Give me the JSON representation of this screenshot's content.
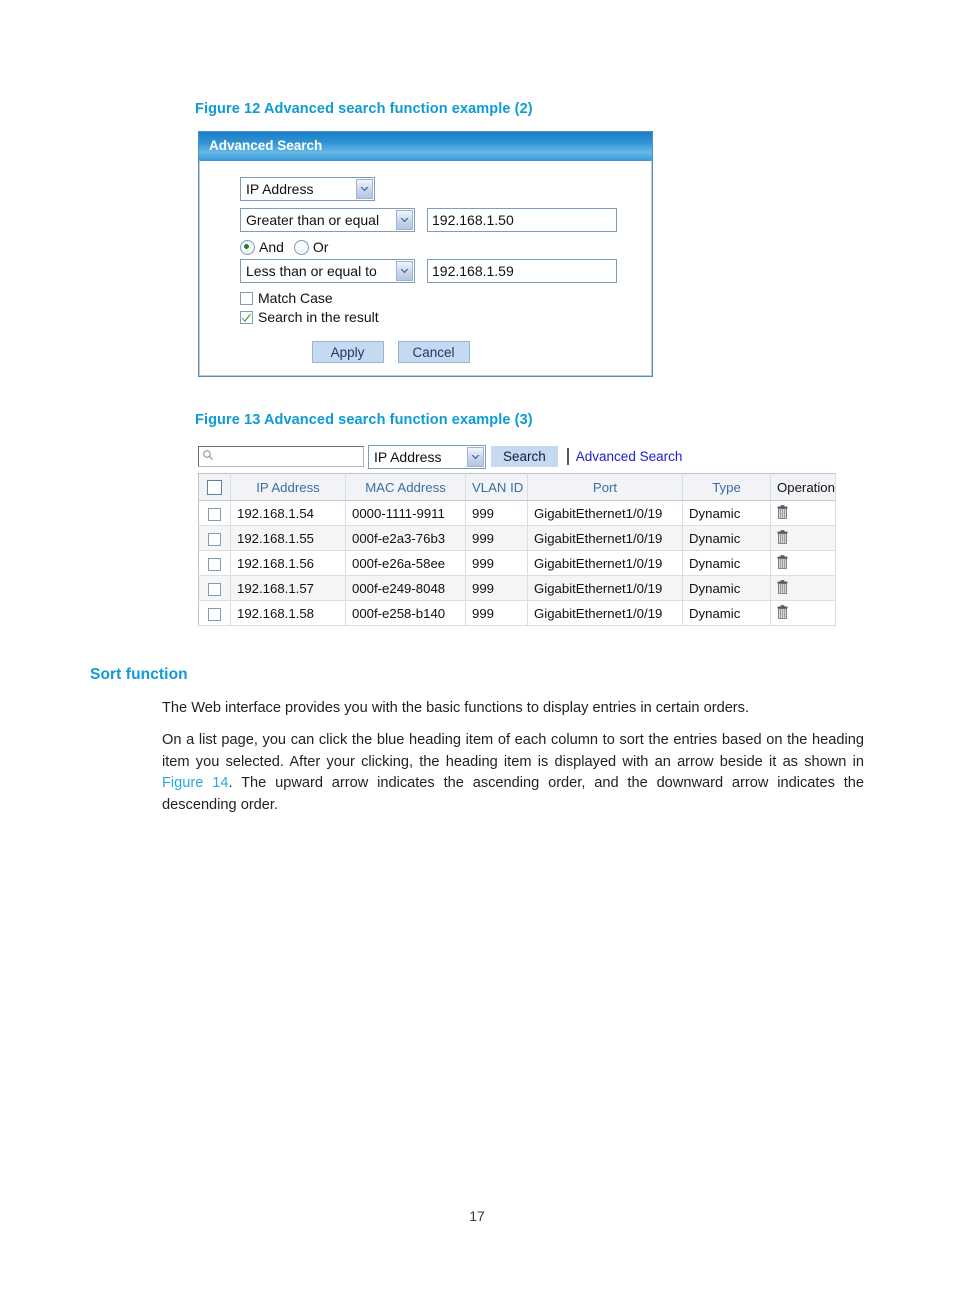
{
  "figure12": {
    "caption": "Figure 12 Advanced search function example (2)",
    "dialog": {
      "title": "Advanced Search",
      "field_select": {
        "value": "IP Address"
      },
      "condition1": {
        "operator": "Greater than or equal",
        "value": "192.168.1.50"
      },
      "logic": {
        "and_label": "And",
        "or_label": "Or",
        "selected": "And"
      },
      "condition2": {
        "operator": "Less than or equal to",
        "value": "192.168.1.59"
      },
      "match_case": {
        "label": "Match Case",
        "checked": false
      },
      "search_in_result": {
        "label": "Search in the result",
        "checked": true
      },
      "apply_label": "Apply",
      "cancel_label": "Cancel"
    }
  },
  "figure13": {
    "caption": "Figure 13 Advanced search function example (3)",
    "searchbar": {
      "input_value": "",
      "input_placeholder": "",
      "field_select": "IP Address",
      "search_label": "Search",
      "advanced_label": "Advanced Search"
    },
    "table": {
      "headers": [
        {
          "label": "",
          "sortable": false
        },
        {
          "label": "IP Address",
          "sortable": true
        },
        {
          "label": "MAC Address",
          "sortable": true
        },
        {
          "label": "VLAN ID",
          "sortable": true
        },
        {
          "label": "Port",
          "sortable": true
        },
        {
          "label": "Type",
          "sortable": true
        },
        {
          "label": "Operation",
          "sortable": false
        }
      ],
      "rows": [
        {
          "ip": "192.168.1.54",
          "mac": "0000-1111-9911",
          "vlan": "999",
          "port": "GigabitEthernet1/0/19",
          "type": "Dynamic"
        },
        {
          "ip": "192.168.1.55",
          "mac": "000f-e2a3-76b3",
          "vlan": "999",
          "port": "GigabitEthernet1/0/19",
          "type": "Dynamic"
        },
        {
          "ip": "192.168.1.56",
          "mac": "000f-e26a-58ee",
          "vlan": "999",
          "port": "GigabitEthernet1/0/19",
          "type": "Dynamic"
        },
        {
          "ip": "192.168.1.57",
          "mac": "000f-e249-8048",
          "vlan": "999",
          "port": "GigabitEthernet1/0/19",
          "type": "Dynamic"
        },
        {
          "ip": "192.168.1.58",
          "mac": "000f-e258-b140",
          "vlan": "999",
          "port": "GigabitEthernet1/0/19",
          "type": "Dynamic"
        }
      ]
    }
  },
  "sort_section": {
    "heading": "Sort function",
    "para1": "The Web interface provides you with the basic functions to display entries in certain orders.",
    "para2_a": "On a list page, you can click the blue heading item of each column to sort the entries based on the heading item you selected. After your clicking, the heading item is displayed with an arrow beside it as shown in ",
    "para2_link": "Figure 14",
    "para2_b": ". The upward arrow indicates the ascending order, and the downward arrow indicates the descending order."
  },
  "footer": {
    "page_number": "17"
  },
  "colors": {
    "caption_blue": "#0e9bd4",
    "link_blue": "#28a8e0",
    "header_blue": "#3a6ea5",
    "dialog_border": "#4a8fd0",
    "button_fill": "#c6d9f1"
  }
}
